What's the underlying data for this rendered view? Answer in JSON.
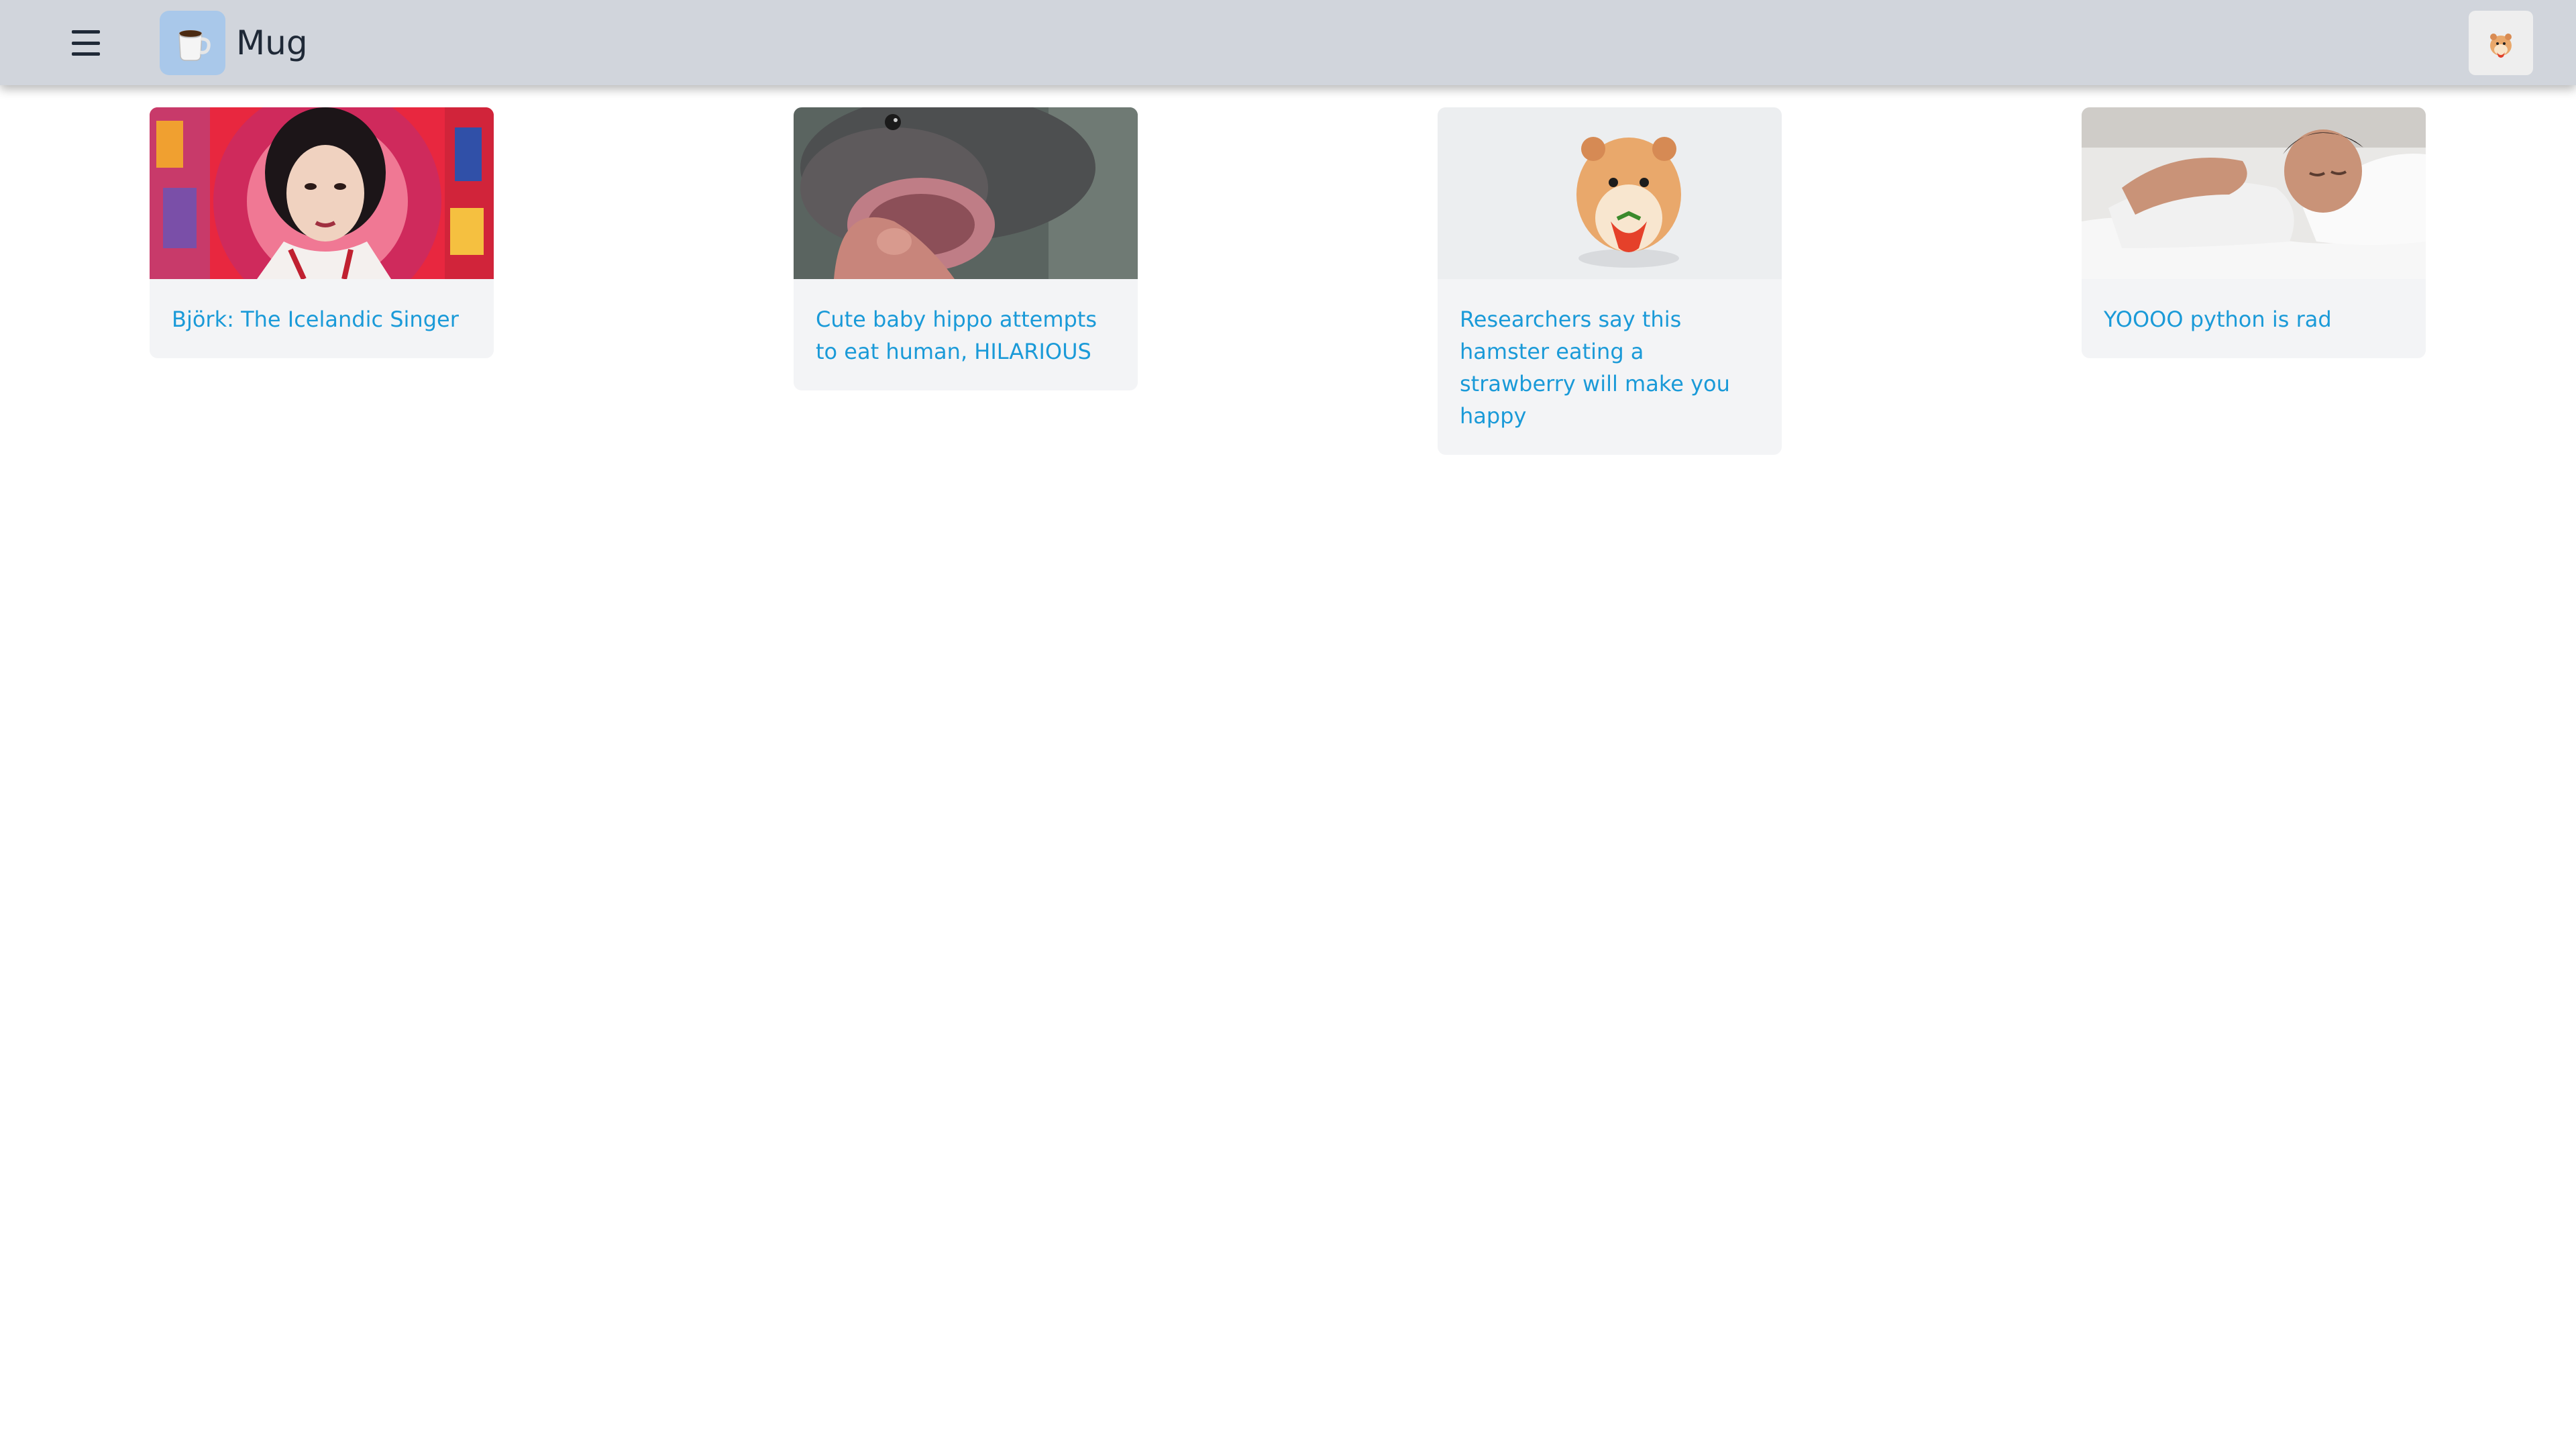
{
  "header": {
    "brand_name": "Mug",
    "menu_icon": "hamburger-menu-icon",
    "logo_icon": "coffee-mug-icon",
    "avatar_icon": "hamster-avatar-icon",
    "background_color": "#d1d5dc"
  },
  "posts": [
    {
      "title": "Björk: The Icelandic Singer",
      "thumbnail": "singer-portrait-photo"
    },
    {
      "title": "Cute baby hippo attempts to eat human, HILARIOUS",
      "thumbnail": "baby-hippo-photo"
    },
    {
      "title": "Researchers say this hamster eating a strawberry will make you happy",
      "thumbnail": "hamster-strawberry-photo"
    },
    {
      "title": "YOOOO python is rad",
      "thumbnail": "sleeping-man-photo"
    }
  ],
  "colors": {
    "link": "#1a9ad8",
    "card_background": "#f3f4f6",
    "logo_background": "#a9c8ea"
  }
}
